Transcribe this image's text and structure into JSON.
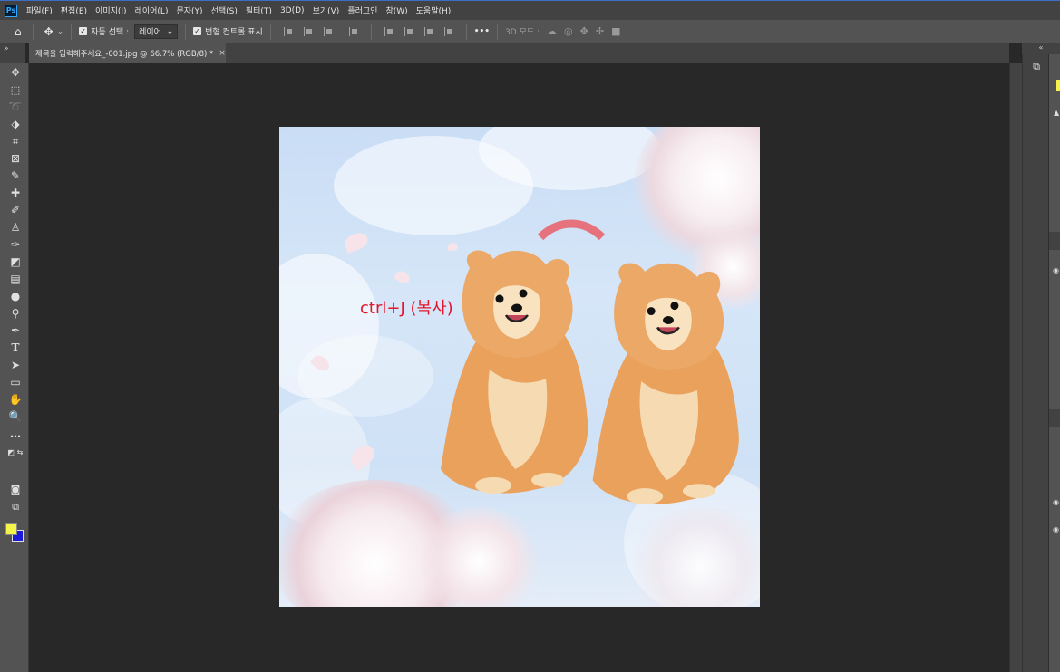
{
  "menubar": {
    "logo": "Ps",
    "items": [
      "파일(F)",
      "편집(E)",
      "이미지(I)",
      "레이어(L)",
      "문자(Y)",
      "선택(S)",
      "필터(T)",
      "3D(D)",
      "보기(V)",
      "플러그인",
      "창(W)",
      "도움말(H)"
    ]
  },
  "options": {
    "auto_select_label": "자동 선택 :",
    "auto_select_value": "레이어",
    "transform_controls_label": "변형 컨트롤 표시",
    "more": "•••",
    "mode_3d_label": "3D 모드 :"
  },
  "panels": {
    "left_collapse": "»",
    "right_collapse": "«"
  },
  "document": {
    "tab_title": "제목을 입력해주세요_-001.jpg @ 66.7% (RGB/8) *",
    "close": "×"
  },
  "canvas": {
    "annotation": "ctrl+J (복사)"
  },
  "colors": {
    "foreground": "#f4f44a",
    "background": "#1a1ad8",
    "annotation": "#e4152c",
    "arc": "#e6727d"
  },
  "tools": [
    "move-icon",
    "marquee-icon",
    "lasso-icon",
    "object-select-icon",
    "crop-icon",
    "frame-icon",
    "eyedropper-icon",
    "healing-brush-icon",
    "brush-icon",
    "clone-stamp-icon",
    "history-brush-icon",
    "eraser-icon",
    "gradient-icon",
    "blur-icon",
    "dodge-icon",
    "pen-icon",
    "type-icon",
    "path-select-icon",
    "rectangle-icon",
    "hand-icon",
    "zoom-icon",
    "more-tools-icon"
  ]
}
